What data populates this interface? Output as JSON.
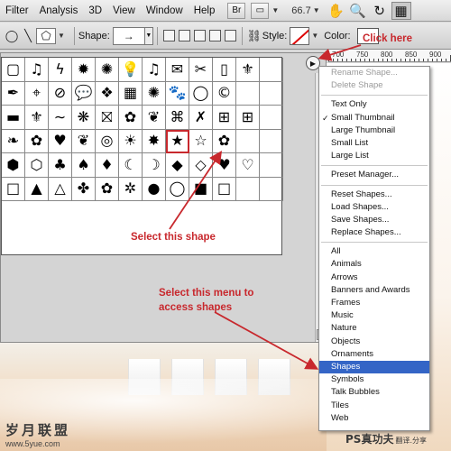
{
  "menubar": {
    "items": [
      "Filter",
      "Analysis",
      "3D",
      "View",
      "Window",
      "Help"
    ],
    "bridge_label": "Br",
    "zoom": "66.7",
    "tool_icons": [
      "hand-icon",
      "zoom-icon",
      "rotate-icon",
      "grid-icon"
    ]
  },
  "optbar": {
    "shape_label": "Shape:",
    "shape_value": "→",
    "style_label": "Style:",
    "color_label": "Color:"
  },
  "shape_grid": {
    "cells": [
      "▢",
      "♫",
      "ϟ",
      "✹",
      "✺",
      "💡",
      "♫",
      "✉",
      "✂",
      "▯",
      "⚜",
      "",
      "✒",
      "⌖",
      "⊘",
      "💬",
      "❖",
      "▦",
      "✺",
      "🐾",
      "◯",
      "©",
      "",
      "",
      "▬",
      "⚜",
      "∼",
      "❋",
      "⛝",
      "✿",
      "❦",
      "⌘",
      "✗",
      "⊞",
      "⊞",
      "",
      "❧",
      "✿",
      "♥",
      "❦",
      "◎",
      "☀",
      "✸",
      "★",
      "☆",
      "✿",
      "",
      "",
      "⬢",
      "⬡",
      "♣",
      "♠",
      "♦",
      "☾",
      "☽",
      "◆",
      "◇",
      "♥",
      "♡",
      "",
      "□",
      "▲",
      "△",
      "✤",
      "✿",
      "✲",
      "●",
      "◯",
      "■",
      "□",
      "",
      ""
    ],
    "selected_index": 43
  },
  "dropdown": {
    "groups": [
      [
        {
          "label": "Rename Shape...",
          "disabled": true
        },
        {
          "label": "Delete Shape",
          "disabled": true
        }
      ],
      [
        {
          "label": "Text Only"
        },
        {
          "label": "Small Thumbnail",
          "checked": true
        },
        {
          "label": "Large Thumbnail"
        },
        {
          "label": "Small List"
        },
        {
          "label": "Large List"
        }
      ],
      [
        {
          "label": "Preset Manager..."
        }
      ],
      [
        {
          "label": "Reset Shapes..."
        },
        {
          "label": "Load Shapes..."
        },
        {
          "label": "Save Shapes..."
        },
        {
          "label": "Replace Shapes..."
        }
      ],
      [
        {
          "label": "All"
        },
        {
          "label": "Animals"
        },
        {
          "label": "Arrows"
        },
        {
          "label": "Banners and Awards"
        },
        {
          "label": "Frames"
        },
        {
          "label": "Music"
        },
        {
          "label": "Nature"
        },
        {
          "label": "Objects"
        },
        {
          "label": "Ornaments"
        },
        {
          "label": "Shapes",
          "highlighted": true
        },
        {
          "label": "Symbols"
        },
        {
          "label": "Talk Bubbles"
        },
        {
          "label": "Tiles"
        },
        {
          "label": "Web"
        }
      ]
    ]
  },
  "ruler": [
    "700",
    "750",
    "800",
    "850",
    "900"
  ],
  "annotations": {
    "click_here": "Click here",
    "select_shape": "Select this shape",
    "select_menu": "Select this menu to access shapes"
  },
  "watermarks": {
    "left_cn": "岁月联盟",
    "left_url": "www.5yue.com",
    "right_main": "PS真功夫",
    "right_sub": "翻译.分享"
  },
  "colors": {
    "annotation": "#c8282d",
    "highlight": "#3465c6"
  }
}
